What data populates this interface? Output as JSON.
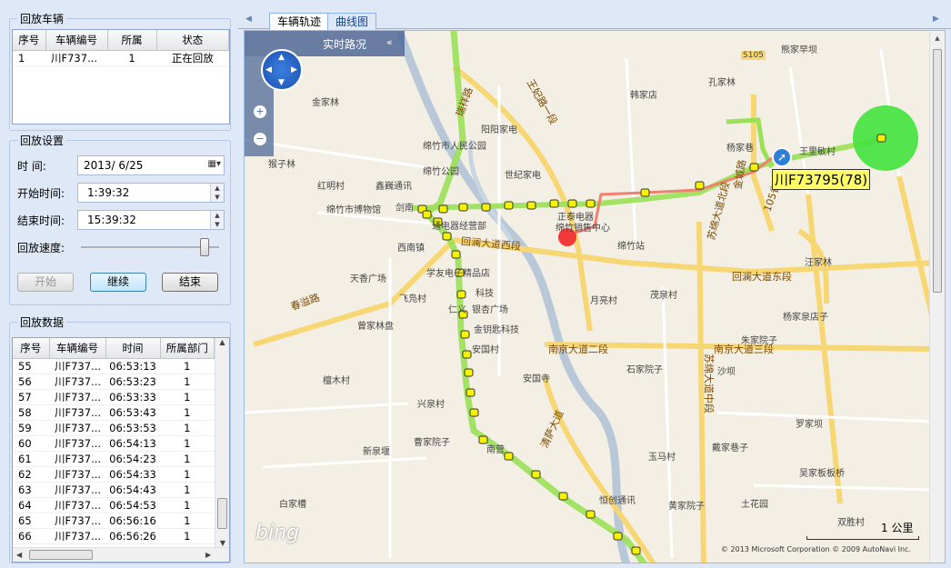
{
  "left": {
    "vehicles": {
      "title": "回放车辆",
      "columns": [
        "序号",
        "车辆编号",
        "所属",
        "状态"
      ],
      "rows": [
        [
          "1",
          "川F737...",
          "1",
          "正在回放"
        ]
      ]
    },
    "settings": {
      "title": "回放设置",
      "time_label": "时    间:",
      "date_value": "2013/  6/25",
      "start_label": "开始时间:",
      "start_value": "1:39:32",
      "end_label": "结束时间:",
      "end_value": "15:39:32",
      "speed_label": "回放速度:",
      "speed_level": 0.92,
      "start_button": "开始",
      "continue_button": "继续",
      "end_button": "结束"
    },
    "data": {
      "title": "回放数据",
      "columns": [
        "序号",
        "车辆编号",
        "时间",
        "所属部门"
      ],
      "rows": [
        [
          "55",
          "川F737...",
          "06:53:13",
          "1"
        ],
        [
          "56",
          "川F737...",
          "06:53:23",
          "1"
        ],
        [
          "57",
          "川F737...",
          "06:53:33",
          "1"
        ],
        [
          "58",
          "川F737...",
          "06:53:43",
          "1"
        ],
        [
          "59",
          "川F737...",
          "06:53:53",
          "1"
        ],
        [
          "60",
          "川F737...",
          "06:54:13",
          "1"
        ],
        [
          "61",
          "川F737...",
          "06:54:23",
          "1"
        ],
        [
          "62",
          "川F737...",
          "06:54:33",
          "1"
        ],
        [
          "63",
          "川F737...",
          "06:54:43",
          "1"
        ],
        [
          "64",
          "川F737...",
          "06:54:53",
          "1"
        ],
        [
          "65",
          "川F737...",
          "06:56:16",
          "1"
        ],
        [
          "66",
          "川F737...",
          "06:56:26",
          "1"
        ]
      ]
    }
  },
  "tabs": [
    "车辆轨迹",
    "曲线图"
  ],
  "map": {
    "realtime_label": "实时路况",
    "collapse_icon": "double-chevron-left-icon",
    "vehicle_label": "川F73795(78)",
    "scale_label": "1 公里",
    "logo": "bing",
    "copyright": "© 2013 Microsoft Corporation   © 2009 AutoNavi Inc.",
    "places": [
      "熊家早坝",
      "孔家林",
      "S105",
      "韩家店",
      "王妃路一段",
      "瑞祥路",
      "金家林",
      "阳阳家电",
      "绵竹市人民公园",
      "绵竹公园",
      "世纪家电",
      "绵竹市博物馆",
      "鑫巍通讯",
      "剑南",
      "通电器经营部",
      "正泰电器",
      "绵竹销售中心",
      "绵竹站",
      "西南镇",
      "回澜大道西段",
      "回澜大道东段",
      "学友电子",
      "精品店",
      "科技",
      "仁义",
      "银杏广场",
      "飞凫村",
      "春溢路",
      "天香广场",
      "曾家林盘",
      "金钥匙科技",
      "安国村",
      "安国寺",
      "南京大道二段",
      "南京大道三段",
      "石家院子",
      "檀木村",
      "兴泉村",
      "曹家院子",
      "新泉堰",
      "南营",
      "恒创通讯",
      "黄家院子",
      "白家槽",
      "月亮村",
      "茂泉村",
      "杨家泉店子",
      "汪家林",
      "罗家坝",
      "吴家板板桥",
      "土花园",
      "双胜村",
      "戴家巷子",
      "玉马村",
      "王里敏村",
      "苏绵大道北段",
      "苏绵大道中段",
      "金城路",
      "105省道",
      "清萨大道",
      "沙坝",
      "杨家巷",
      "朱家院子",
      "红明村",
      "猴子林"
    ]
  },
  "colors": {
    "track": "#8ee04a",
    "current": "#f06a5a",
    "circle": "#43e23c",
    "accent": "#2f7fd6"
  }
}
